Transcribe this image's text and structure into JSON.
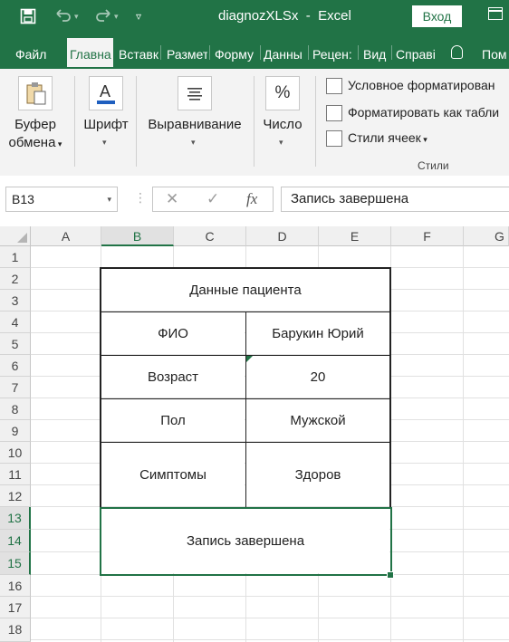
{
  "titlebar": {
    "save_icon": "save-icon",
    "undo_icon": "undo-icon",
    "redo_icon": "redo-icon",
    "customize_icon": "customize-qat-icon",
    "filename": "diagnozXLSx",
    "separator": "-",
    "app": "Excel",
    "signin": "Вход"
  },
  "tabs": [
    "Файл",
    "Главна",
    "Вставк",
    "Размет",
    "Форму",
    "Данны",
    "Рецен:",
    "Вид",
    "Справі",
    "Пом"
  ],
  "ribbon": {
    "clipboard": {
      "line1": "Буфер",
      "line2": "обмена"
    },
    "font": "Шрифт",
    "alignment": "Выравнивание",
    "number": "Число",
    "number_symbol": "%",
    "styles": {
      "conditional": "Условное форматирован",
      "format_table": "Форматировать как табли",
      "cell_styles": "Стили ячеек",
      "caption": "Стили"
    }
  },
  "formula_bar": {
    "name_box": "B13",
    "cancel": "✕",
    "enter": "✓",
    "fx": "fx",
    "content": "Запись завершена"
  },
  "columns": [
    "A",
    "B",
    "C",
    "D",
    "E",
    "F",
    "G"
  ],
  "rows": [
    "1",
    "2",
    "3",
    "4",
    "5",
    "6",
    "7",
    "8",
    "9",
    "10",
    "11",
    "12",
    "13",
    "14",
    "15",
    "16",
    "17",
    "18"
  ],
  "table": {
    "title": "Данные пациента",
    "rows": [
      {
        "label": "ФИО",
        "value": "Барукин Юрий"
      },
      {
        "label": "Возраст",
        "value": "20"
      },
      {
        "label": "Пол",
        "value": "Мужской"
      },
      {
        "label": "Симптомы",
        "value": "Здоров"
      }
    ],
    "footer": "Запись завершена"
  },
  "colors": {
    "accent": "#217346"
  }
}
